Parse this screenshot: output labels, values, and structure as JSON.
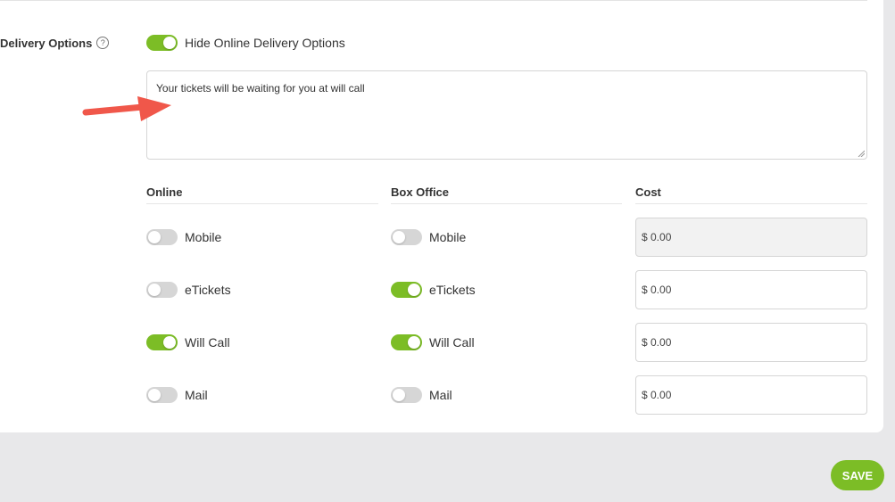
{
  "delivery": {
    "label": "Delivery Options",
    "help_icon": "question-circle-icon",
    "hide_online": {
      "label": "Hide Online Delivery Options",
      "on": true
    },
    "message": "Your tickets will be waiting for you at will call"
  },
  "columns": {
    "online": "Online",
    "box_office": "Box Office",
    "cost": "Cost"
  },
  "rows": [
    {
      "name": "Mobile",
      "online_label": "Mobile",
      "online_on": false,
      "box_label": "Mobile",
      "box_on": false,
      "cost": "$ 0.00",
      "cost_disabled": true
    },
    {
      "name": "eTickets",
      "online_label": "eTickets",
      "online_on": false,
      "box_label": "eTickets",
      "box_on": true,
      "cost": "$ 0.00",
      "cost_disabled": false
    },
    {
      "name": "Will Call",
      "online_label": "Will Call",
      "online_on": true,
      "box_label": "Will Call",
      "box_on": true,
      "cost": "$ 0.00",
      "cost_disabled": false
    },
    {
      "name": "Mail",
      "online_label": "Mail",
      "online_on": false,
      "box_label": "Mail",
      "box_on": false,
      "cost": "$ 0.00",
      "cost_disabled": false
    }
  ],
  "save_label": "SAVE",
  "colors": {
    "accent": "#7cbd26",
    "toggle_off": "#d6d6d6",
    "arrow": "#f0574a"
  }
}
